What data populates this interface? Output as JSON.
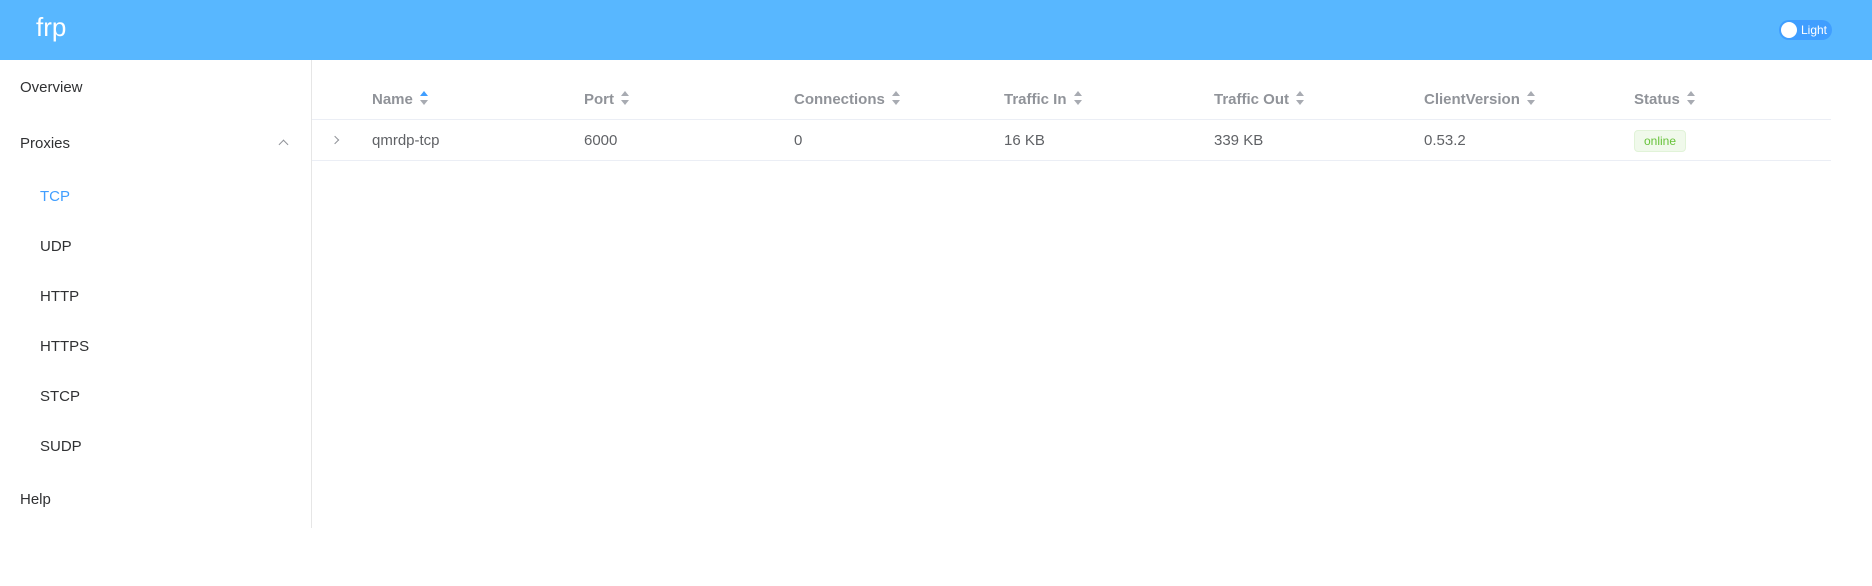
{
  "app": {
    "title": "frp"
  },
  "theme_toggle": {
    "label": "Light",
    "accent": "#409eff"
  },
  "sidebar": {
    "overview": "Overview",
    "proxies": "Proxies",
    "items": [
      "TCP",
      "UDP",
      "HTTP",
      "HTTPS",
      "STCP",
      "SUDP"
    ],
    "active_item": "TCP",
    "help": "Help"
  },
  "table": {
    "columns": [
      "Name",
      "Port",
      "Connections",
      "Traffic In",
      "Traffic Out",
      "ClientVersion",
      "Status"
    ],
    "sorted_column": "Name",
    "rows": [
      {
        "name": "qmrdp-tcp",
        "port": "6000",
        "connections": "0",
        "traffic_in": "16 KB",
        "traffic_out": "339 KB",
        "client_version": "0.53.2",
        "status": "online"
      }
    ]
  },
  "colors": {
    "header_bg": "#58b7ff",
    "active_text": "#409eff",
    "status_online": "#67c23a"
  }
}
